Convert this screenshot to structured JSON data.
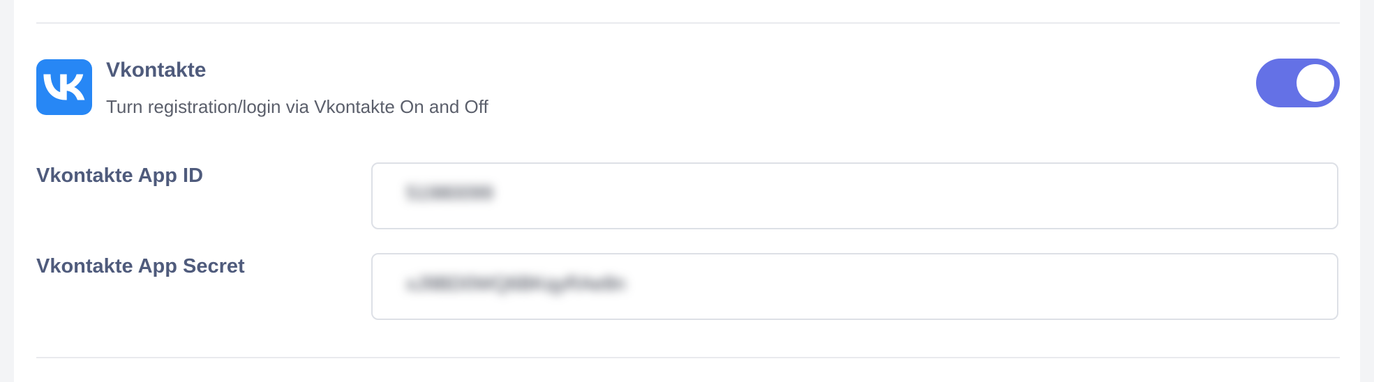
{
  "provider": {
    "name": "Vkontakte",
    "description": "Turn registration/login via Vkontakte On and Off",
    "icon": "vk-logo-icon",
    "brand_color": "#2787f5",
    "enabled": true,
    "toggle_color": "#6471e6"
  },
  "fields": {
    "app_id": {
      "label": "Vkontakte App ID",
      "value": "51980099"
    },
    "app_secret": {
      "label": "Vkontakte App Secret",
      "value": "xJ9BD0WQ6BKqyRAe8n"
    }
  }
}
